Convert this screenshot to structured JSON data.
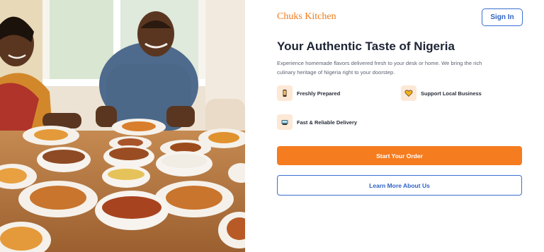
{
  "brand": {
    "name": "Chuks Kitchen",
    "color": "#f07a1a"
  },
  "header": {
    "sign_in_label": "Sign In"
  },
  "hero": {
    "title": "Your Authentic Taste of Nigeria",
    "description": "Experience homemade flavors delivered fresh to your desk or home. We bring the rich culinary heritage of Nigeria right to your doorstep."
  },
  "features": [
    {
      "label": "Freshly Prepared",
      "icon": "phone-icon"
    },
    {
      "label": "Support Local Business",
      "icon": "heart-icon"
    },
    {
      "label": "Fast & Reliable Delivery",
      "icon": "delivery-icon"
    }
  ],
  "actions": {
    "primary_label": "Start Your Order",
    "secondary_label": "Learn More About Us"
  },
  "colors": {
    "accent": "#f57c1f",
    "link_blue": "#3b6fd1",
    "icon_bg": "#fde8d6"
  }
}
